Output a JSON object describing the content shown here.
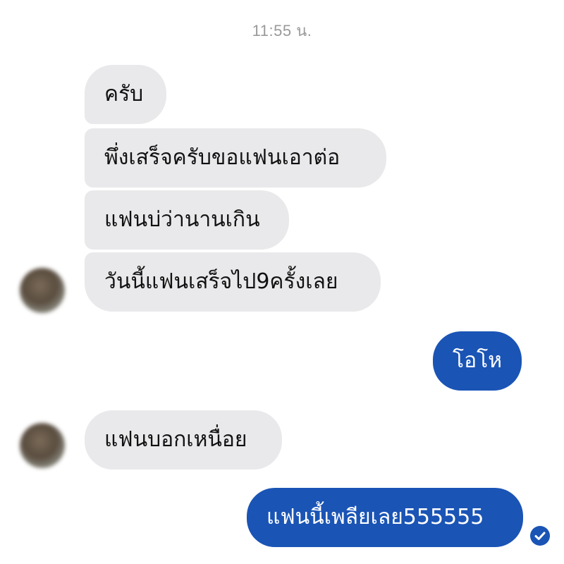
{
  "timestamp": "11:55 น.",
  "messages": [
    {
      "id": "b1",
      "text": "ครับ",
      "direction": "incoming"
    },
    {
      "id": "b2",
      "text": "พึ่งเสร็จครับขอแฟนเอาต่อ",
      "direction": "incoming"
    },
    {
      "id": "b3",
      "text": "แฟนบ่ว่านานเกิน",
      "direction": "incoming"
    },
    {
      "id": "b4",
      "text": "วันนี้แฟนเสร็จไป9ครั้งเลย",
      "direction": "incoming"
    },
    {
      "id": "b5",
      "text": "โอโห",
      "direction": "outgoing"
    },
    {
      "id": "b6",
      "text": "แฟนบอกเหนื่อย",
      "direction": "incoming"
    },
    {
      "id": "b7",
      "text": "แฟนนี้เพลียเลย555555",
      "direction": "outgoing"
    }
  ],
  "icons": {
    "avatar": "contact-avatar",
    "read_receipt": "check-circle-icon"
  },
  "colors": {
    "incoming_bubble": "#e9e9eb",
    "outgoing_bubble": "#1a54b5",
    "timestamp": "#9a9a9a"
  }
}
